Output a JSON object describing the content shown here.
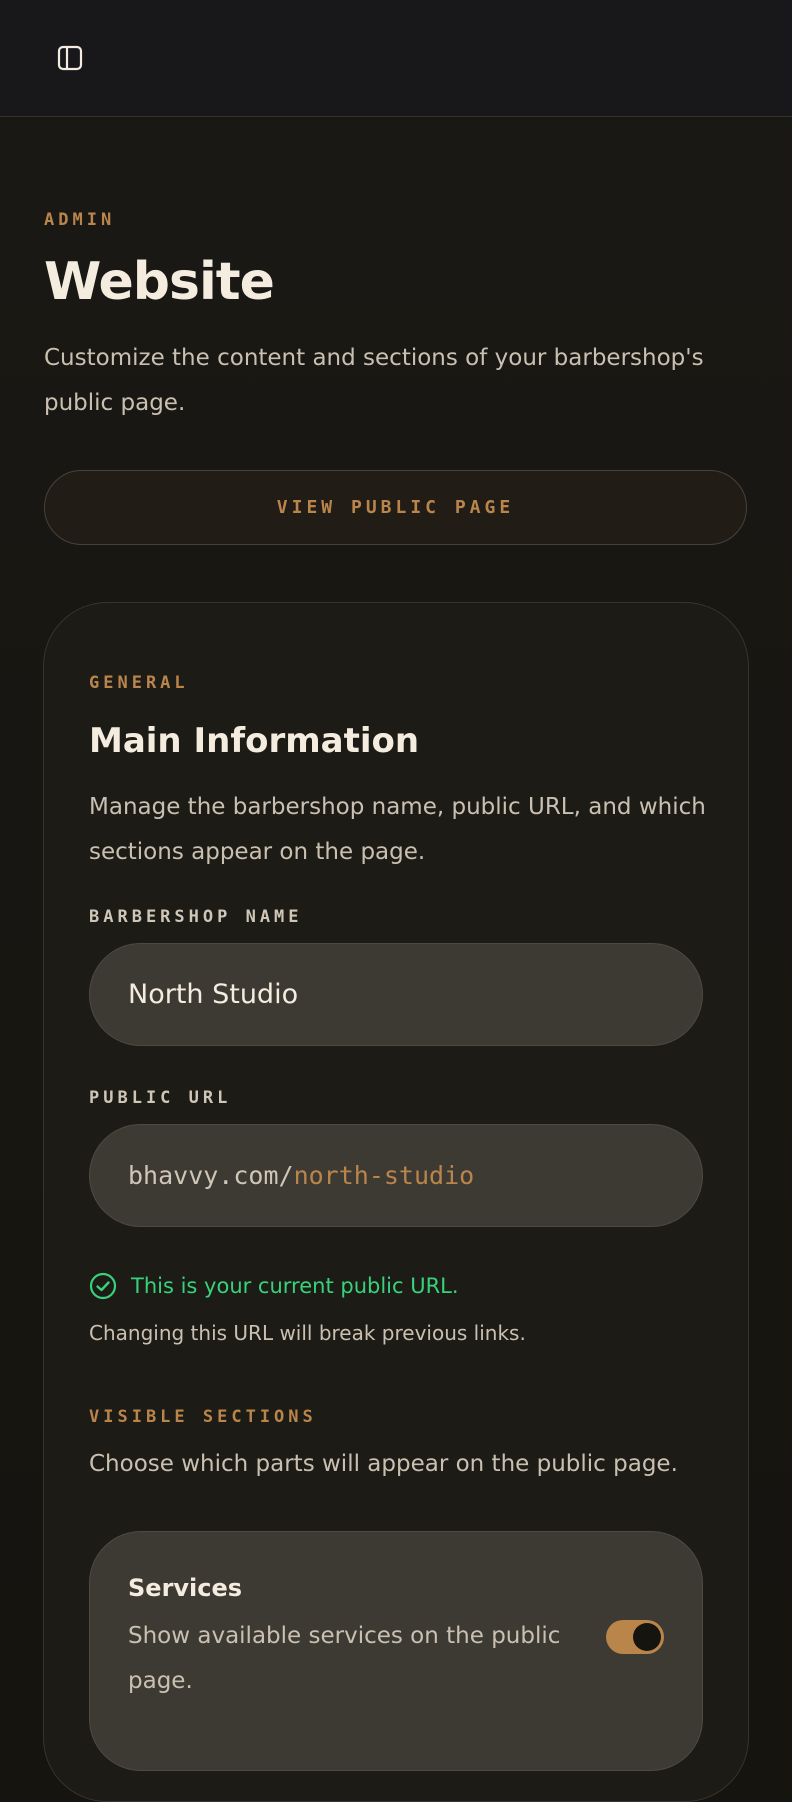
{
  "topbar": {
    "toggle_icon": "sidebar-panel-icon"
  },
  "header": {
    "eyebrow": "ADMIN",
    "title": "Website",
    "description": "Customize the content and sections of your barbershop's public page.",
    "view_button_label": "VIEW PUBLIC PAGE"
  },
  "card": {
    "eyebrow": "GENERAL",
    "title": "Main Information",
    "description": "Manage the barbershop name, public URL, and which sections appear on the page.",
    "name_field": {
      "label": "BARBERSHOP NAME",
      "value": "North Studio"
    },
    "url_field": {
      "label": "PUBLIC URL",
      "prefix": "bhavvy.com/",
      "slug": "north-studio",
      "status": "This is your current public URL.",
      "warning": "Changing this URL will break previous links."
    },
    "sections": {
      "eyebrow": "VISIBLE SECTIONS",
      "description": "Choose which parts will appear on the public page.",
      "items": [
        {
          "title": "Services",
          "description": "Show available services on the public page.",
          "enabled": true
        }
      ]
    }
  },
  "colors": {
    "accent": "#b9854b",
    "success": "#37d27b",
    "background": "#16140f"
  }
}
